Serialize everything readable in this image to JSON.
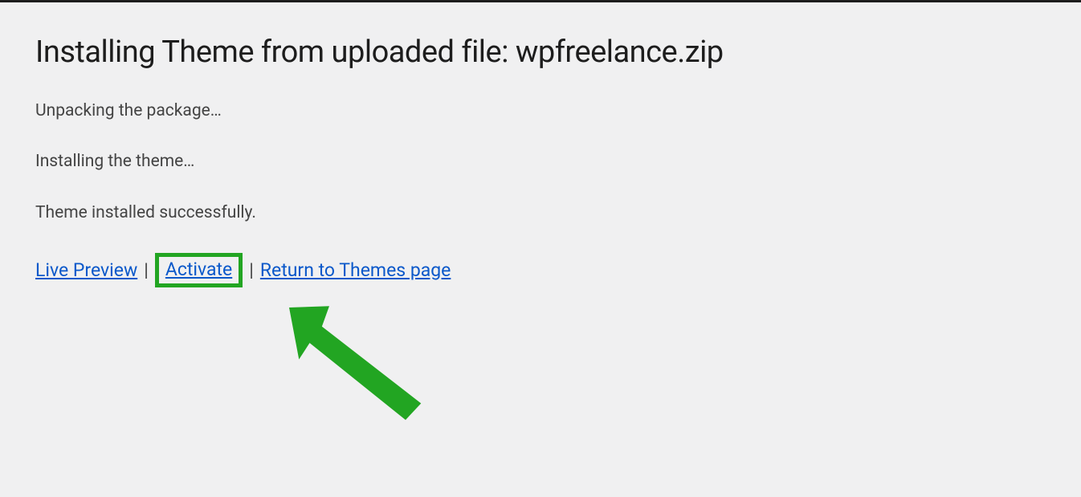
{
  "header": {
    "title": "Installing Theme from uploaded file: wpfreelance.zip"
  },
  "status_messages": {
    "unpacking": "Unpacking the package…",
    "installing": "Installing the theme…",
    "success": "Theme installed successfully."
  },
  "actions": {
    "live_preview": "Live Preview",
    "activate": "Activate",
    "return": "Return to Themes page",
    "separator": "|"
  },
  "annotation": {
    "highlight_color": "#22a522",
    "arrow_color": "#22a522"
  }
}
